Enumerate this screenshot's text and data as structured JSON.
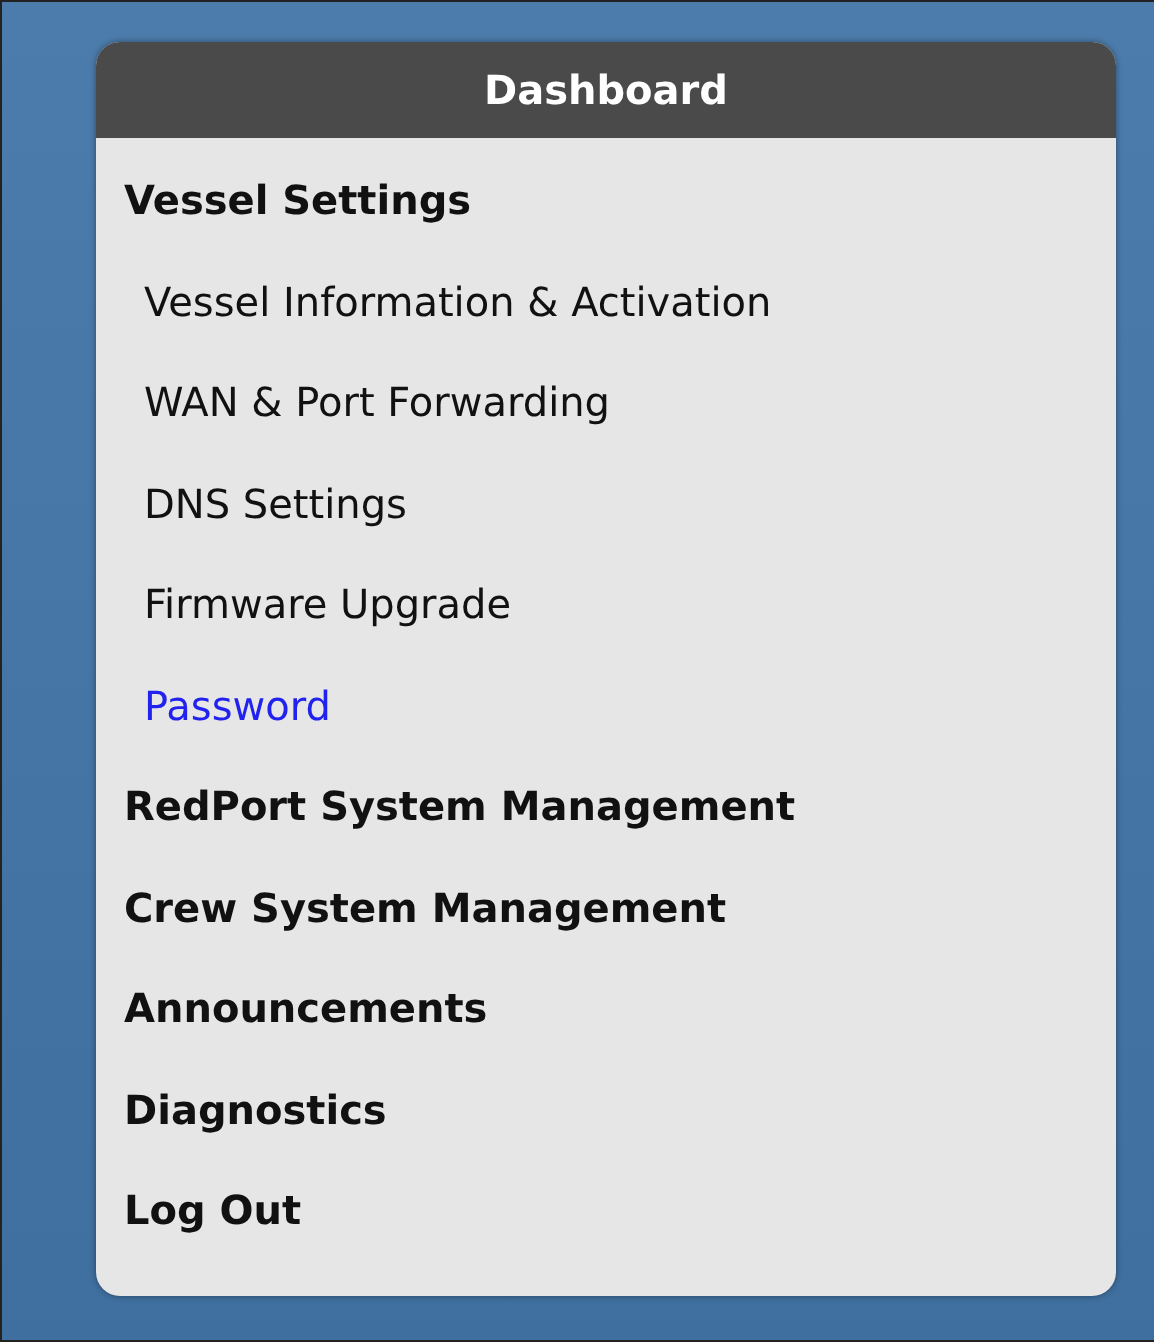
{
  "panel": {
    "title": "Dashboard"
  },
  "menu": [
    {
      "label": "Vessel Settings",
      "selected": false,
      "children": [
        {
          "label": "Vessel Information & Activation",
          "selected": false
        },
        {
          "label": "WAN & Port Forwarding",
          "selected": false
        },
        {
          "label": "DNS Settings",
          "selected": false
        },
        {
          "label": "Firmware Upgrade",
          "selected": false
        },
        {
          "label": "Password",
          "selected": true
        }
      ]
    },
    {
      "label": "RedPort System Management",
      "selected": false
    },
    {
      "label": "Crew System Management",
      "selected": false
    },
    {
      "label": "Announcements",
      "selected": false
    },
    {
      "label": "Diagnostics",
      "selected": false
    },
    {
      "label": "Log Out",
      "selected": false
    }
  ]
}
